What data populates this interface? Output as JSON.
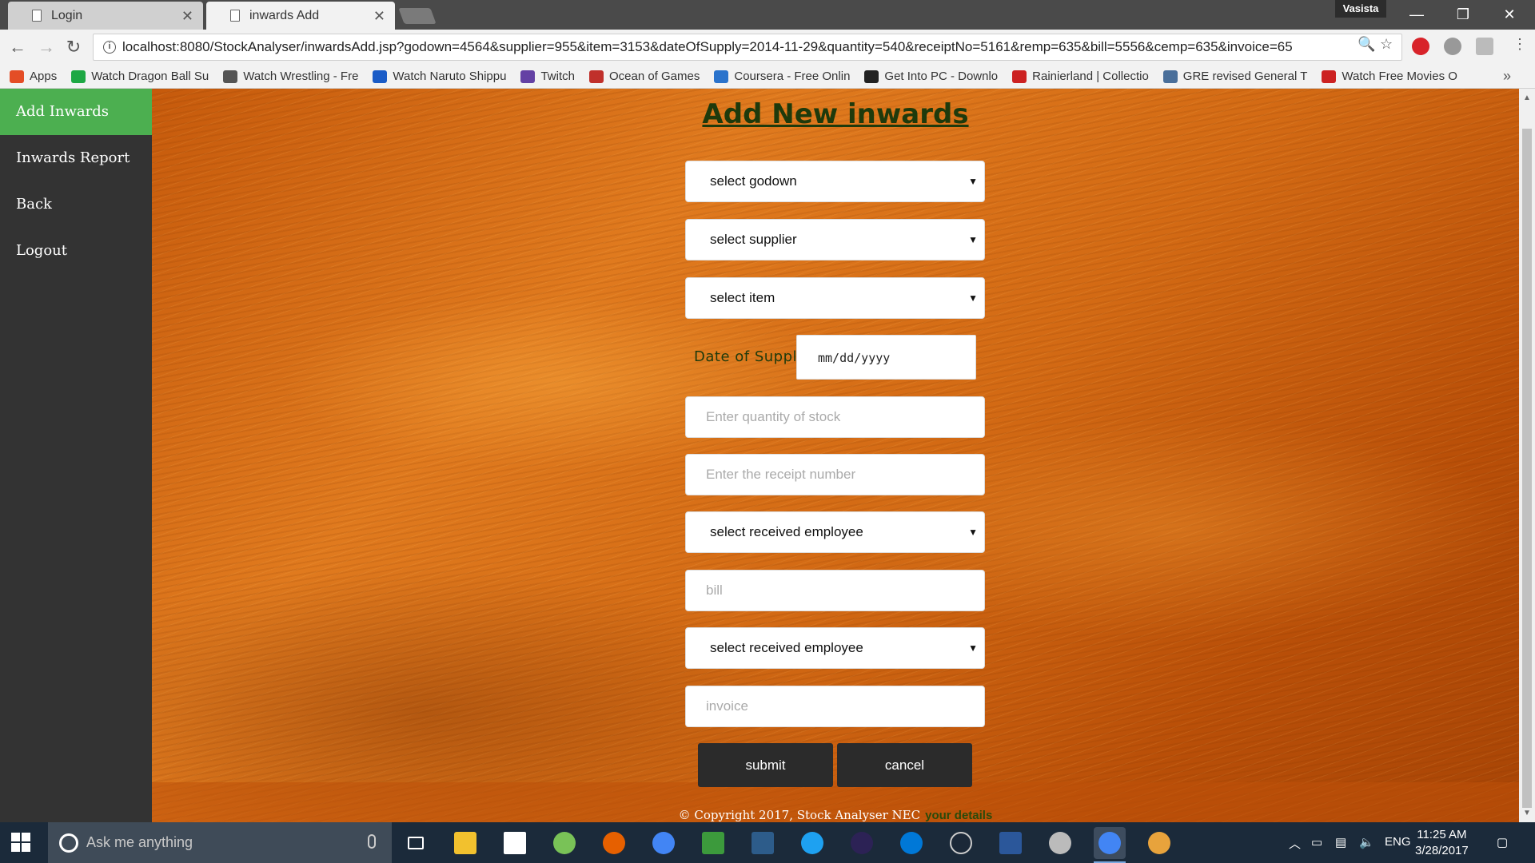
{
  "browser": {
    "tabs": [
      {
        "label": "Login",
        "active": false
      },
      {
        "label": "inwards Add",
        "active": true
      }
    ],
    "user": "Vasista",
    "url": "localhost:8080/StockAnalyser/inwardsAdd.jsp?godown=4564&supplier=955&item=3153&dateOfSupply=2014-11-29&quantity=540&receiptNo=5161&remp=635&bill=5556&cemp=635&invoice=65",
    "bookmarks": [
      {
        "label": "Apps",
        "color": "#e44d26"
      },
      {
        "label": "Watch Dragon Ball Su",
        "color": "#1ea844"
      },
      {
        "label": "Watch Wrestling - Fre",
        "color": "#555555"
      },
      {
        "label": "Watch Naruto Shippu",
        "color": "#1a5cc7"
      },
      {
        "label": "Twitch",
        "color": "#6441a4"
      },
      {
        "label": "Ocean of Games",
        "color": "#c0302b"
      },
      {
        "label": "Coursera - Free Onlin",
        "color": "#2a73cc"
      },
      {
        "label": "Get Into PC - Downlo",
        "color": "#222222"
      },
      {
        "label": "Rainierland | Collectio",
        "color": "#cc2222"
      },
      {
        "label": "GRE revised General T",
        "color": "#4a6f9a"
      },
      {
        "label": "Watch Free Movies O",
        "color": "#cc2222"
      }
    ],
    "bookmarks_more": "»"
  },
  "sidebar": {
    "items": [
      {
        "label": "Add Inwards",
        "active": true
      },
      {
        "label": "Inwards Report",
        "active": false
      },
      {
        "label": "Back",
        "active": false
      },
      {
        "label": "Logout",
        "active": false
      }
    ]
  },
  "form": {
    "title": "Add New inwards",
    "godown_select": "select godown",
    "supplier_select": "select supplier",
    "item_select": "select item",
    "date_label": "Date of Supply",
    "date_placeholder": "mm/dd/yyyy",
    "quantity_placeholder": "Enter quantity of stock",
    "receipt_placeholder": "Enter the receipt number",
    "received_employee_select": "select received employee",
    "bill_placeholder": "bill",
    "cemp_select": "select received employee",
    "invoice_placeholder": "invoice",
    "submit_label": "submit",
    "cancel_label": "cancel"
  },
  "footer": {
    "copyright": "© Copyright 2017, Stock Analyser NEC",
    "details": "your details"
  },
  "taskbar": {
    "search_placeholder": "Ask me anything",
    "language": "ENG",
    "time": "11:25 AM",
    "date": "3/28/2017",
    "apps": [
      {
        "name": "task-view",
        "color": "#ffffff"
      },
      {
        "name": "file-explorer",
        "color": "#f2c12e"
      },
      {
        "name": "store",
        "color": "#ffffff"
      },
      {
        "name": "android-studio",
        "color": "#79c257"
      },
      {
        "name": "firefox",
        "color": "#e66000"
      },
      {
        "name": "chrome",
        "color": "#4285f4"
      },
      {
        "name": "app-green",
        "color": "#3c9a3c"
      },
      {
        "name": "app-blue",
        "color": "#2d5c8a"
      },
      {
        "name": "internet-explorer",
        "color": "#1ea1f1"
      },
      {
        "name": "eclipse",
        "color": "#2c2255"
      },
      {
        "name": "edge",
        "color": "#0078d7"
      },
      {
        "name": "steam",
        "color": "#1b2838"
      },
      {
        "name": "word",
        "color": "#2b579a"
      },
      {
        "name": "settings-gear",
        "color": "#bbbbbb"
      },
      {
        "name": "chrome-active",
        "color": "#4285f4"
      },
      {
        "name": "paint",
        "color": "#e8a33c"
      }
    ]
  }
}
